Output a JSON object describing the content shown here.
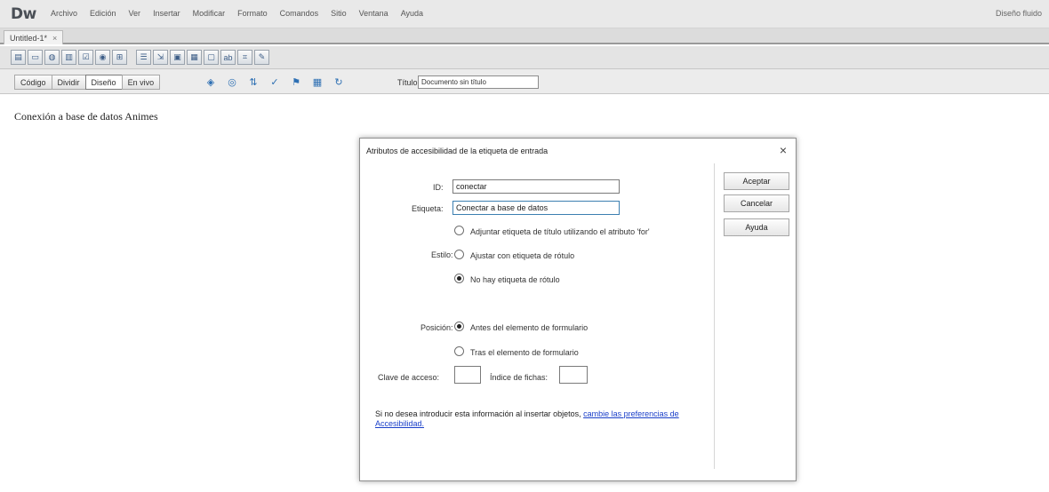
{
  "app": {
    "logo": "Dw",
    "workspace": "Diseño fluido",
    "menus": [
      "Archivo",
      "Edición",
      "Ver",
      "Insertar",
      "Modificar",
      "Formato",
      "Comandos",
      "Sitio",
      "Ventana",
      "Ayuda"
    ]
  },
  "tab": {
    "name": "Untitled-1*",
    "close": "×"
  },
  "doc_toolbar": {
    "views": [
      "Código",
      "Dividir",
      "Diseño",
      "En vivo"
    ],
    "active_view": "Diseño",
    "title_label": "Título:",
    "title_value": "Documento sin título"
  },
  "page": {
    "heading": "Conexión a base de datos Animes"
  },
  "dialog": {
    "title": "Atributos de accesibilidad de la etiqueta de entrada",
    "close": "×",
    "buttons": {
      "accept": "Aceptar",
      "cancel": "Cancelar",
      "help": "Ayuda"
    },
    "id_label": "ID:",
    "id_value": "conectar",
    "label_label": "Etiqueta:",
    "label_value": "Conectar a base de datos",
    "style_label": "Estilo:",
    "style_options": [
      {
        "label": "Adjuntar etiqueta de título utilizando el atributo 'for'",
        "checked": false
      },
      {
        "label": "Ajustar con etiqueta de rótulo",
        "checked": false
      },
      {
        "label": "No hay etiqueta de rótulo",
        "checked": true
      }
    ],
    "position_label": "Posición:",
    "position_options": [
      {
        "label": "Antes del elemento de formulario",
        "checked": true
      },
      {
        "label": "Tras el elemento de formulario",
        "checked": false
      }
    ],
    "access_key_label": "Clave de acceso:",
    "access_key_value": "",
    "tab_index_label": "Índice de fichas:",
    "tab_index_value": "",
    "note_text": "Si no desea introducir esta información al insertar objetos, ",
    "note_link": "cambie las preferencias de Accesibilidad."
  }
}
